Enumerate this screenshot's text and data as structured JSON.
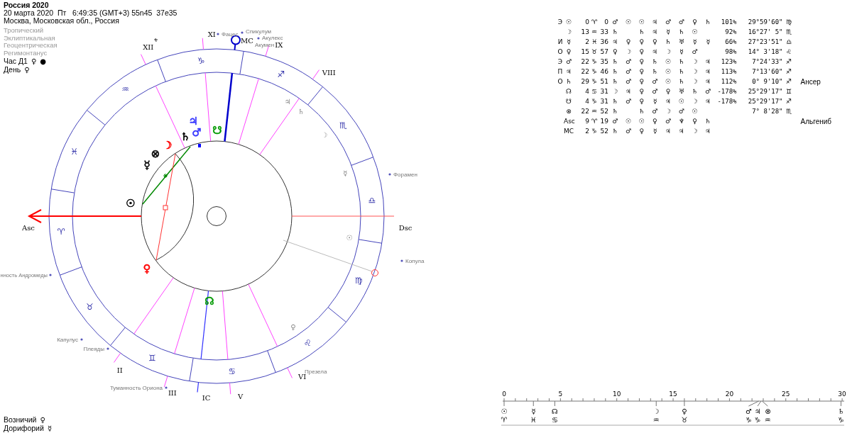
{
  "chart_header": {
    "title": "Россия 2020",
    "datetime": "20 марта 2020  Пт   6:49:35 (GMT+3) 55n45  37e35",
    "place": "Москва, Московская обл., Россия",
    "settings": [
      "Тропический",
      "Эклиптикальная",
      "Геоцентрическая",
      "Регимонтанус"
    ],
    "hour_line": {
      "label": "Час Д1",
      "ruler": "♀",
      "marker": "●"
    },
    "day_line": {
      "label": "День",
      "ruler": "♀"
    }
  },
  "wheel": {
    "signs": [
      "♈",
      "♉",
      "♊",
      "♋",
      "♌",
      "♍",
      "♎",
      "♏",
      "♐",
      "♑",
      "♒",
      "♓"
    ],
    "houses": [
      {
        "label": "Asc",
        "kind": "asc"
      },
      {
        "label": "II",
        "kind": "cusp"
      },
      {
        "label": "III",
        "kind": "cusp"
      },
      {
        "label": "IC",
        "kind": "ic"
      },
      {
        "label": "V",
        "kind": "cusp"
      },
      {
        "label": "VI",
        "kind": "cusp"
      },
      {
        "label": "Dsc",
        "kind": "dsc"
      },
      {
        "label": "VIII",
        "kind": "cusp"
      },
      {
        "label": "IX",
        "kind": "cusp"
      },
      {
        "label": "MC",
        "kind": "mc"
      },
      {
        "label": "XI",
        "kind": "cusp"
      },
      {
        "label": "XII",
        "kind": "cusp"
      }
    ],
    "planets": [
      {
        "glyph": "♃",
        "color": "#3333ff"
      },
      {
        "glyph": "♂",
        "color": "#3333ff"
      },
      {
        "glyph": "♄",
        "color": "#000000"
      },
      {
        "glyph": "☽",
        "color": "#ff0000"
      },
      {
        "glyph": "⊗",
        "color": "#000000"
      },
      {
        "glyph": "☿",
        "color": "#000000"
      },
      {
        "glyph": "☉",
        "color": "#000000"
      },
      {
        "glyph": "♀",
        "color": "#ff0000"
      },
      {
        "glyph": "☋",
        "color": "#009900"
      },
      {
        "glyph": "☊",
        "color": "#009900"
      }
    ],
    "ring_marks": [
      "♃",
      "♄",
      "☽",
      "☿",
      "☉",
      "♀"
    ],
    "stars": [
      "Фацес",
      "Спикулум",
      "Акулекс",
      "Акумен",
      "Форамен",
      "Копула",
      "нность Андромеды",
      "Капулус",
      "Плеяды",
      "Туманность Ориона",
      "Презела"
    ]
  },
  "footer_stars": [
    {
      "name": "Возничий",
      "planet": "♀"
    },
    {
      "name": "Дорифорий",
      "planet": "☿"
    }
  ],
  "table": {
    "rows": [
      {
        "prefix": "Э",
        "body": "☉",
        "degree": "0",
        "sign": "♈",
        "minute": "0",
        "dignities": [
          {
            "kind": "symbol",
            "glyph": "♂"
          },
          {
            "kind": "symbol",
            "glyph": "☉"
          },
          {
            "kind": "symbol",
            "glyph": "☉"
          },
          {
            "kind": "symbol",
            "glyph": "♃"
          },
          {
            "kind": "symbol",
            "glyph": "♂"
          },
          {
            "kind": "symbol",
            "glyph": "♂"
          },
          {
            "kind": "symbol",
            "glyph": "♀"
          },
          {
            "kind": "symbol",
            "glyph": "♄"
          }
        ],
        "percent": "101%",
        "position": "29°59'60\"",
        "position_sign": "♍"
      },
      {
        "body": "☽",
        "degree": "13",
        "sign": "♒",
        "minute": "33",
        "dignities": [
          {
            "kind": "symbol",
            "glyph": "♄"
          },
          {
            "kind": "empty"
          },
          {
            "kind": "symbol",
            "glyph": "♄"
          },
          {
            "kind": "symbol",
            "glyph": "♃"
          },
          {
            "kind": "symbol",
            "glyph": "☿"
          },
          {
            "kind": "symbol",
            "glyph": "♄"
          },
          {
            "kind": "symbol",
            "glyph": "☉"
          },
          {
            "kind": "empty"
          }
        ],
        "percent": "92%",
        "position": "16°27' 5\"",
        "position_sign": "♏"
      },
      {
        "prefix": "И",
        "body": "☿",
        "degree": "2",
        "sign": "♓",
        "minute": "36",
        "dignities": [
          {
            "kind": "symbol",
            "glyph": "♃"
          },
          {
            "kind": "symbol",
            "glyph": "♀"
          },
          {
            "kind": "symbol",
            "glyph": "♀"
          },
          {
            "kind": "symbol",
            "glyph": "♀"
          },
          {
            "kind": "symbol",
            "glyph": "♄"
          },
          {
            "kind": "symbol",
            "glyph": "♅"
          },
          {
            "kind": "symbol",
            "glyph": "☿"
          },
          {
            "kind": "symbol",
            "glyph": "☿"
          }
        ],
        "percent": "66%",
        "position": "27°23'51\"",
        "position_sign": "♎"
      },
      {
        "prefix": "О",
        "body": "♀",
        "degree": "15",
        "sign": "♉",
        "minute": "57",
        "dignities": [
          {
            "kind": "symbol",
            "glyph": "♀"
          },
          {
            "kind": "symbol",
            "glyph": "☽"
          },
          {
            "kind": "symbol",
            "glyph": "♀"
          },
          {
            "kind": "symbol",
            "glyph": "♃"
          },
          {
            "kind": "symbol",
            "glyph": "☽"
          },
          {
            "kind": "symbol",
            "glyph": "☿"
          },
          {
            "kind": "symbol",
            "glyph": "♂"
          },
          {
            "kind": "empty"
          }
        ],
        "percent": "98%",
        "position": "14° 3'18\"",
        "position_sign": "♌"
      },
      {
        "prefix": "Э",
        "body": "♂",
        "degree": "22",
        "sign": "♑",
        "minute": "35",
        "dignities": [
          {
            "kind": "symbol",
            "glyph": "♄"
          },
          {
            "kind": "symbol",
            "glyph": "♂"
          },
          {
            "kind": "symbol",
            "glyph": "♀"
          },
          {
            "kind": "symbol",
            "glyph": "♄"
          },
          {
            "kind": "symbol",
            "glyph": "☉"
          },
          {
            "kind": "symbol",
            "glyph": "♄"
          },
          {
            "kind": "symbol",
            "glyph": "☽"
          },
          {
            "kind": "symbol",
            "glyph": "♃"
          }
        ],
        "percent": "123%",
        "position": "7°24'33\"",
        "position_sign": "♐"
      },
      {
        "prefix": "П",
        "body": "♃",
        "degree": "22",
        "sign": "♑",
        "minute": "46",
        "dignities": [
          {
            "kind": "symbol",
            "glyph": "♄"
          },
          {
            "kind": "symbol",
            "glyph": "♂"
          },
          {
            "kind": "symbol",
            "glyph": "♀"
          },
          {
            "kind": "symbol",
            "glyph": "♄"
          },
          {
            "kind": "symbol",
            "glyph": "☉"
          },
          {
            "kind": "symbol",
            "glyph": "♄"
          },
          {
            "kind": "symbol",
            "glyph": "☽"
          },
          {
            "kind": "symbol",
            "glyph": "♃"
          }
        ],
        "percent": "113%",
        "position": "7°13'60\"",
        "position_sign": "♐"
      },
      {
        "prefix": "О",
        "body": "♄",
        "degree": "29",
        "sign": "♑",
        "minute": "51",
        "dignities": [
          {
            "kind": "symbol",
            "glyph": "♄"
          },
          {
            "kind": "symbol",
            "glyph": "♂"
          },
          {
            "kind": "symbol",
            "glyph": "♀"
          },
          {
            "kind": "symbol",
            "glyph": "♂"
          },
          {
            "kind": "symbol",
            "glyph": "☉"
          },
          {
            "kind": "symbol",
            "glyph": "♄"
          },
          {
            "kind": "symbol",
            "glyph": "☽"
          },
          {
            "kind": "symbol",
            "glyph": "♃"
          }
        ],
        "percent": "112%",
        "position": "0° 9'10\"",
        "position_sign": "♐",
        "star": "Ансер"
      },
      {
        "body": "☊",
        "degree": "4",
        "sign": "♋",
        "minute": "31",
        "dignities": [
          {
            "kind": "symbol",
            "glyph": "☽"
          },
          {
            "kind": "symbol",
            "glyph": "♃"
          },
          {
            "kind": "symbol",
            "glyph": "♀"
          },
          {
            "kind": "symbol",
            "glyph": "♂"
          },
          {
            "kind": "symbol",
            "glyph": "♀"
          },
          {
            "kind": "symbol",
            "glyph": "♅"
          },
          {
            "kind": "symbol",
            "glyph": "♄"
          },
          {
            "kind": "symbol",
            "glyph": "♂"
          }
        ],
        "percent": "-178%",
        "position": "25°29'17\"",
        "position_sign": "♊"
      },
      {
        "body": "☋",
        "degree": "4",
        "sign": "♑",
        "minute": "31",
        "dignities": [
          {
            "kind": "symbol",
            "glyph": "♄"
          },
          {
            "kind": "symbol",
            "glyph": "♂"
          },
          {
            "kind": "symbol",
            "glyph": "♀"
          },
          {
            "kind": "symbol",
            "glyph": "☿"
          },
          {
            "kind": "symbol",
            "glyph": "♃"
          },
          {
            "kind": "symbol",
            "glyph": "☉"
          },
          {
            "kind": "symbol",
            "glyph": "☽"
          },
          {
            "kind": "symbol",
            "glyph": "♃"
          }
        ],
        "percent": "-178%",
        "position": "25°29'17\"",
        "position_sign": "♐"
      },
      {
        "body": "⊗",
        "degree": "22",
        "sign": "♒",
        "minute": "52",
        "dignities": [
          {
            "kind": "symbol",
            "glyph": "♄"
          },
          {
            "kind": "empty"
          },
          {
            "kind": "symbol",
            "glyph": "♄"
          },
          {
            "kind": "symbol",
            "glyph": "♂"
          },
          {
            "kind": "symbol",
            "glyph": "☽"
          },
          {
            "kind": "symbol",
            "glyph": "♂"
          },
          {
            "kind": "symbol",
            "glyph": "☉"
          },
          {
            "kind": "empty"
          }
        ],
        "position": "7° 8'28\"",
        "position_sign": "♏"
      },
      {
        "body": "Asc",
        "degree": "9",
        "sign": "♈",
        "minute": "19",
        "dignities": [
          {
            "kind": "symbol",
            "glyph": "♂"
          },
          {
            "kind": "symbol",
            "glyph": "☉"
          },
          {
            "kind": "symbol",
            "glyph": "☉"
          },
          {
            "kind": "symbol",
            "glyph": "♀"
          },
          {
            "kind": "symbol",
            "glyph": "♂"
          },
          {
            "kind": "symbol",
            "glyph": "♆"
          },
          {
            "kind": "symbol",
            "glyph": "♀"
          },
          {
            "kind": "symbol",
            "glyph": "♄"
          }
        ],
        "star": "Альгениб"
      },
      {
        "body": "MC",
        "degree": "2",
        "sign": "♑",
        "minute": "52",
        "dignities": [
          {
            "kind": "symbol",
            "glyph": "♄"
          },
          {
            "kind": "symbol",
            "glyph": "♂"
          },
          {
            "kind": "symbol",
            "glyph": "♀"
          },
          {
            "kind": "symbol",
            "glyph": "☿"
          },
          {
            "kind": "symbol",
            "glyph": "♃"
          },
          {
            "kind": "symbol",
            "glyph": "♃"
          },
          {
            "kind": "symbol",
            "glyph": "☽"
          },
          {
            "kind": "symbol",
            "glyph": "♃"
          }
        ]
      }
    ]
  },
  "degree_scale": {
    "ticks": [
      "0",
      "5",
      "10",
      "15",
      "20",
      "25",
      "30"
    ],
    "markers": [
      {
        "planet": "☉",
        "sign": "♈"
      },
      {
        "planet": "☿",
        "sign": "♓"
      },
      {
        "planet": "☊",
        "sign": "♋"
      },
      {
        "planet": "☽",
        "sign": "♒"
      },
      {
        "planet": "♀",
        "sign": "♉"
      },
      {
        "planet": "♂",
        "sign": "♑"
      },
      {
        "planet": "♃",
        "sign": "♑"
      },
      {
        "planet": "⊗",
        "sign": "♒"
      },
      {
        "planet": "♄",
        "sign": "♑"
      }
    ]
  }
}
